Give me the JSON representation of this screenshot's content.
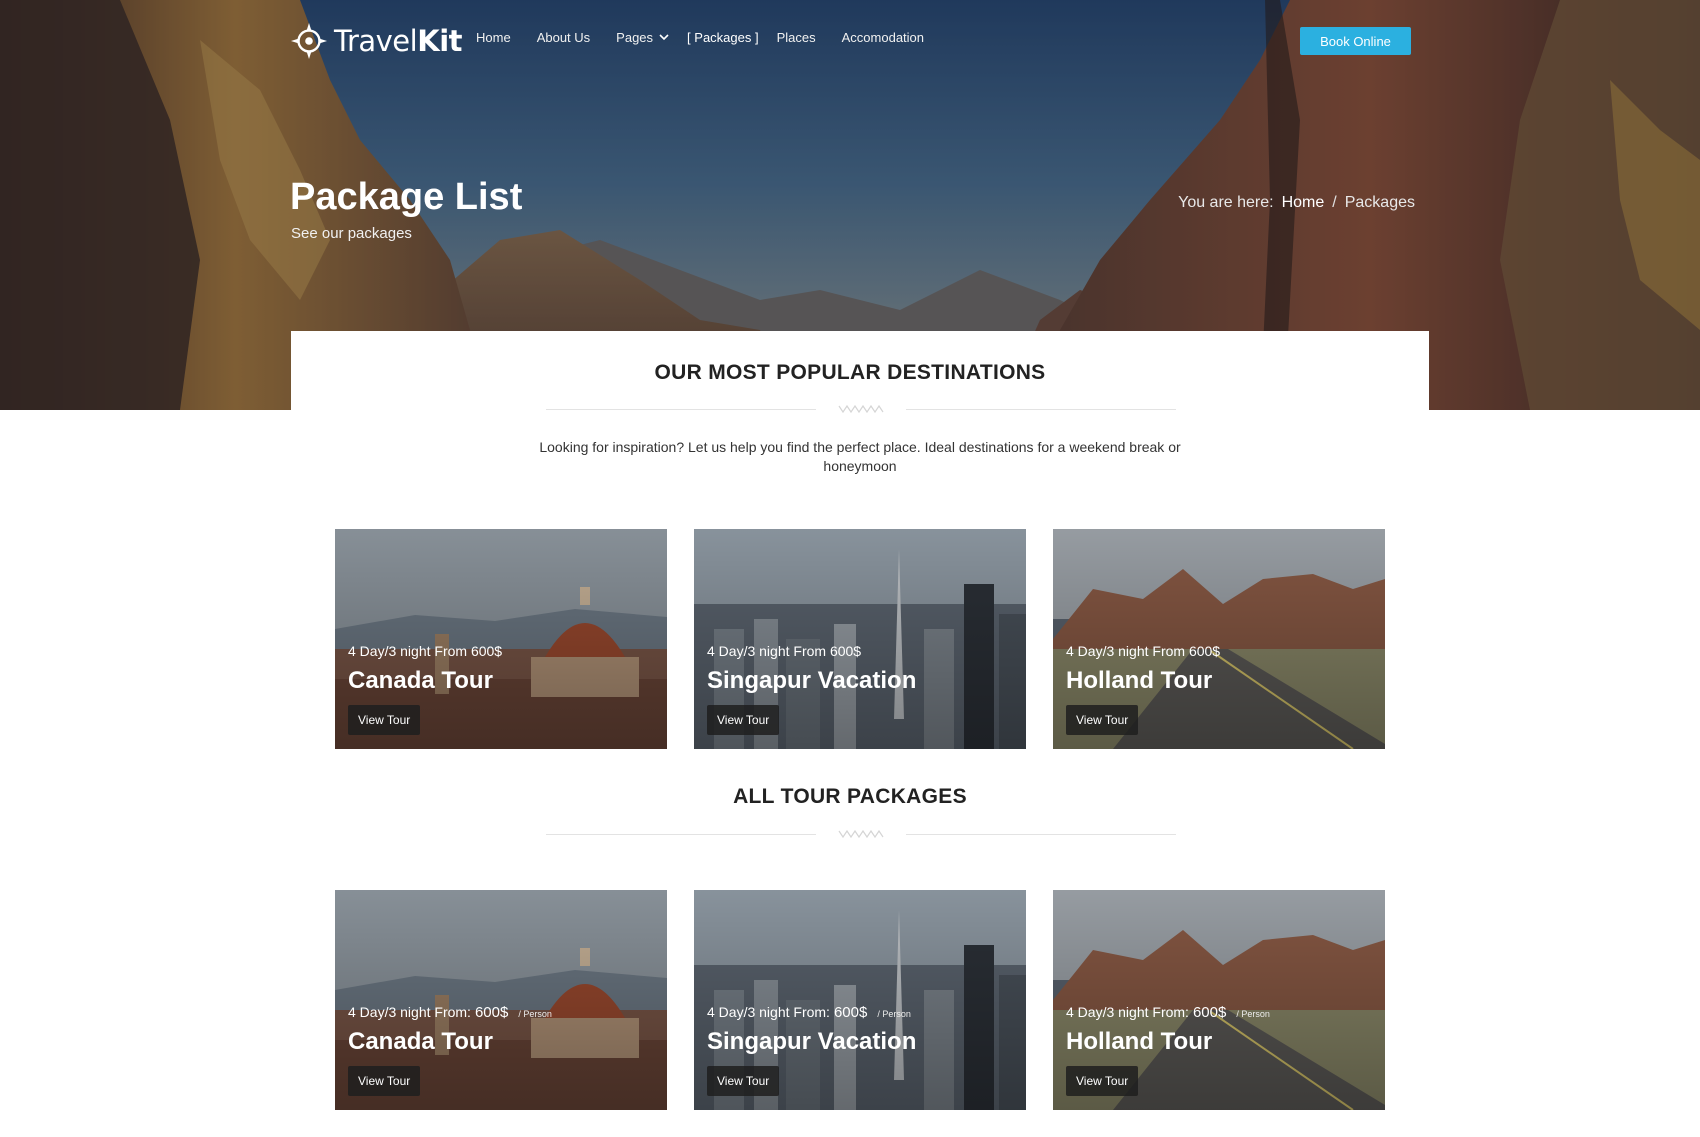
{
  "brand": {
    "name_light": "Travel",
    "name_bold": "Kit"
  },
  "nav": {
    "items": [
      {
        "label": "Home"
      },
      {
        "label": "About Us"
      },
      {
        "label": "Pages"
      },
      {
        "label": "[ Packages ]"
      },
      {
        "label": "Places"
      },
      {
        "label": "Accomodation"
      }
    ],
    "book_label": "Book Online"
  },
  "hero": {
    "title": "Package List",
    "subtitle": "See our packages",
    "breadcrumb": {
      "prefix": "You are here:",
      "home": "Home",
      "sep": "/",
      "current": "Packages"
    }
  },
  "popular": {
    "title": "OUR MOST POPULAR DESTINATIONS",
    "intro": "Looking for inspiration? Let us help you find the perfect place. Ideal destinations for a weekend break or honeymoon",
    "cards": [
      {
        "meta": "4 Day/3 night From 600$",
        "name": "Canada Tour",
        "button": "View Tour"
      },
      {
        "meta": "4 Day/3 night From 600$",
        "name": "Singapur Vacation",
        "button": "View Tour"
      },
      {
        "meta": "4 Day/3 night From 600$",
        "name": "Holland Tour",
        "button": "View Tour"
      }
    ]
  },
  "all": {
    "title": "ALL TOUR PACKAGES",
    "cards": [
      {
        "meta": "4 Day/3 night From:",
        "price": "600$",
        "per": "/ Person",
        "name": "Canada Tour",
        "button": "View Tour"
      },
      {
        "meta": "4 Day/3 night From:",
        "price": "600$",
        "per": "/ Person",
        "name": "Singapur Vacation",
        "button": "View Tour"
      },
      {
        "meta": "4 Day/3 night From:",
        "price": "600$",
        "per": "/ Person",
        "name": "Holland Tour",
        "button": "View Tour"
      }
    ]
  },
  "colors": {
    "accent": "#2bb0e0",
    "button_dark": "#1e1e1e",
    "text": "#222222"
  },
  "icons": {
    "logo": "compass-icon",
    "pages_dropdown": "chevron-down-icon",
    "divider": "wave-icon"
  }
}
